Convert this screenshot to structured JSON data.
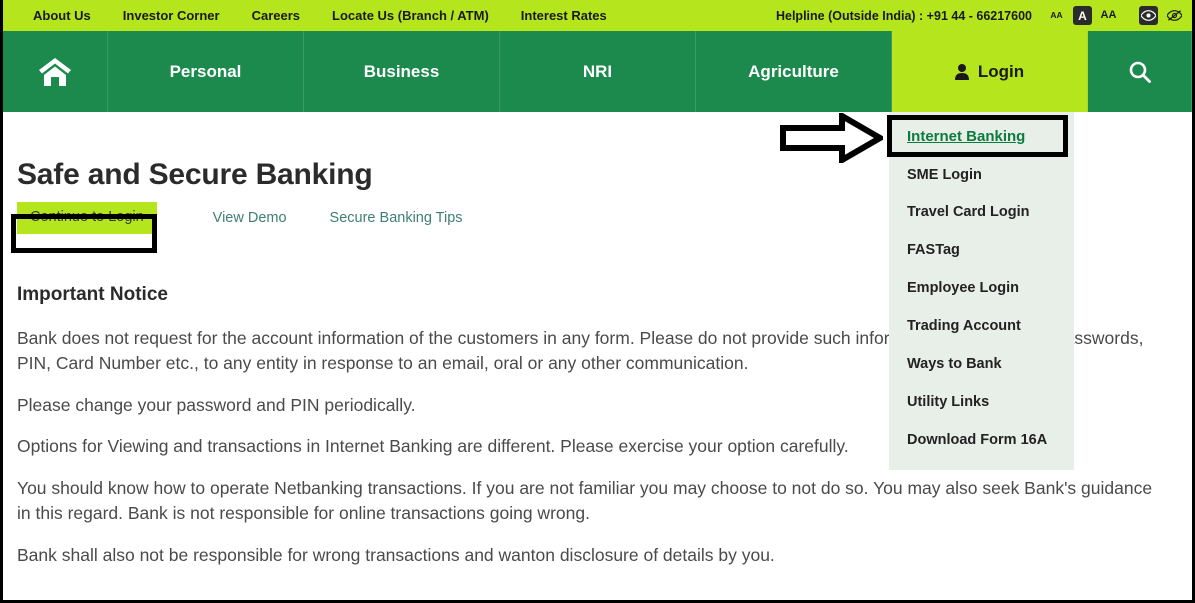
{
  "topbar": {
    "links": [
      {
        "label": "About Us"
      },
      {
        "label": "Investor Corner"
      },
      {
        "label": "Careers"
      },
      {
        "label": "Locate Us (Branch / ATM)"
      },
      {
        "label": "Interest Rates"
      }
    ],
    "helpline": "Helpline (Outside India) : +91 44 - 66217600",
    "accessibility": {
      "decrease_font": "AA",
      "normal_font": "A",
      "increase_font": "AA",
      "high_contrast": "eye-icon",
      "contrast_off": "eye-slash-icon"
    }
  },
  "mainnav": {
    "home": "home-icon",
    "items": [
      {
        "label": "Personal"
      },
      {
        "label": "Business"
      },
      {
        "label": "NRI"
      },
      {
        "label": "Agriculture"
      }
    ],
    "login": {
      "label": "Login",
      "icon": "user-icon"
    },
    "search": {
      "icon": "search-icon"
    }
  },
  "login_dropdown": {
    "items": [
      {
        "label": "Internet Banking",
        "highlighted": true
      },
      {
        "label": "SME Login"
      },
      {
        "label": "Travel Card Login"
      },
      {
        "label": "FASTag"
      },
      {
        "label": "Employee Login"
      },
      {
        "label": "Trading Account"
      },
      {
        "label": "Ways to Bank"
      },
      {
        "label": "Utility Links"
      },
      {
        "label": "Download Form 16A"
      }
    ]
  },
  "main": {
    "title": "Safe and Secure Banking",
    "continue_button": "Continue to Login",
    "view_demo": "View Demo",
    "secure_tips": "Secure Banking Tips",
    "notice_title": "Important Notice",
    "paragraphs": [
      "Bank does not request for the account information of the customers in any form. Please do not provide such information like Login ID, Passwords, PIN, Card Number etc., to any entity in response to an email, oral or any other communication.",
      "Please change your password and PIN periodically.",
      "Options for Viewing and transactions in Internet Banking are different. Please exercise your option carefully.",
      "You should know how to operate Netbanking transactions. If you are not familiar you may choose to not do so. You may also seek Bank's guidance in this regard. Bank is not responsible for online transactions going wrong.",
      "Bank shall also not be responsible for wrong transactions and wanton disclosure of details by you."
    ]
  },
  "annotations": {
    "arrow": "right-arrow-annotation",
    "internet_banking_box": "highlight-box",
    "continue_box": "highlight-box"
  },
  "colors": {
    "lime": "#b5e61d",
    "green": "#1c8a4d",
    "link_green": "#0d7a3e",
    "dropdown_bg": "#e8efe9"
  }
}
